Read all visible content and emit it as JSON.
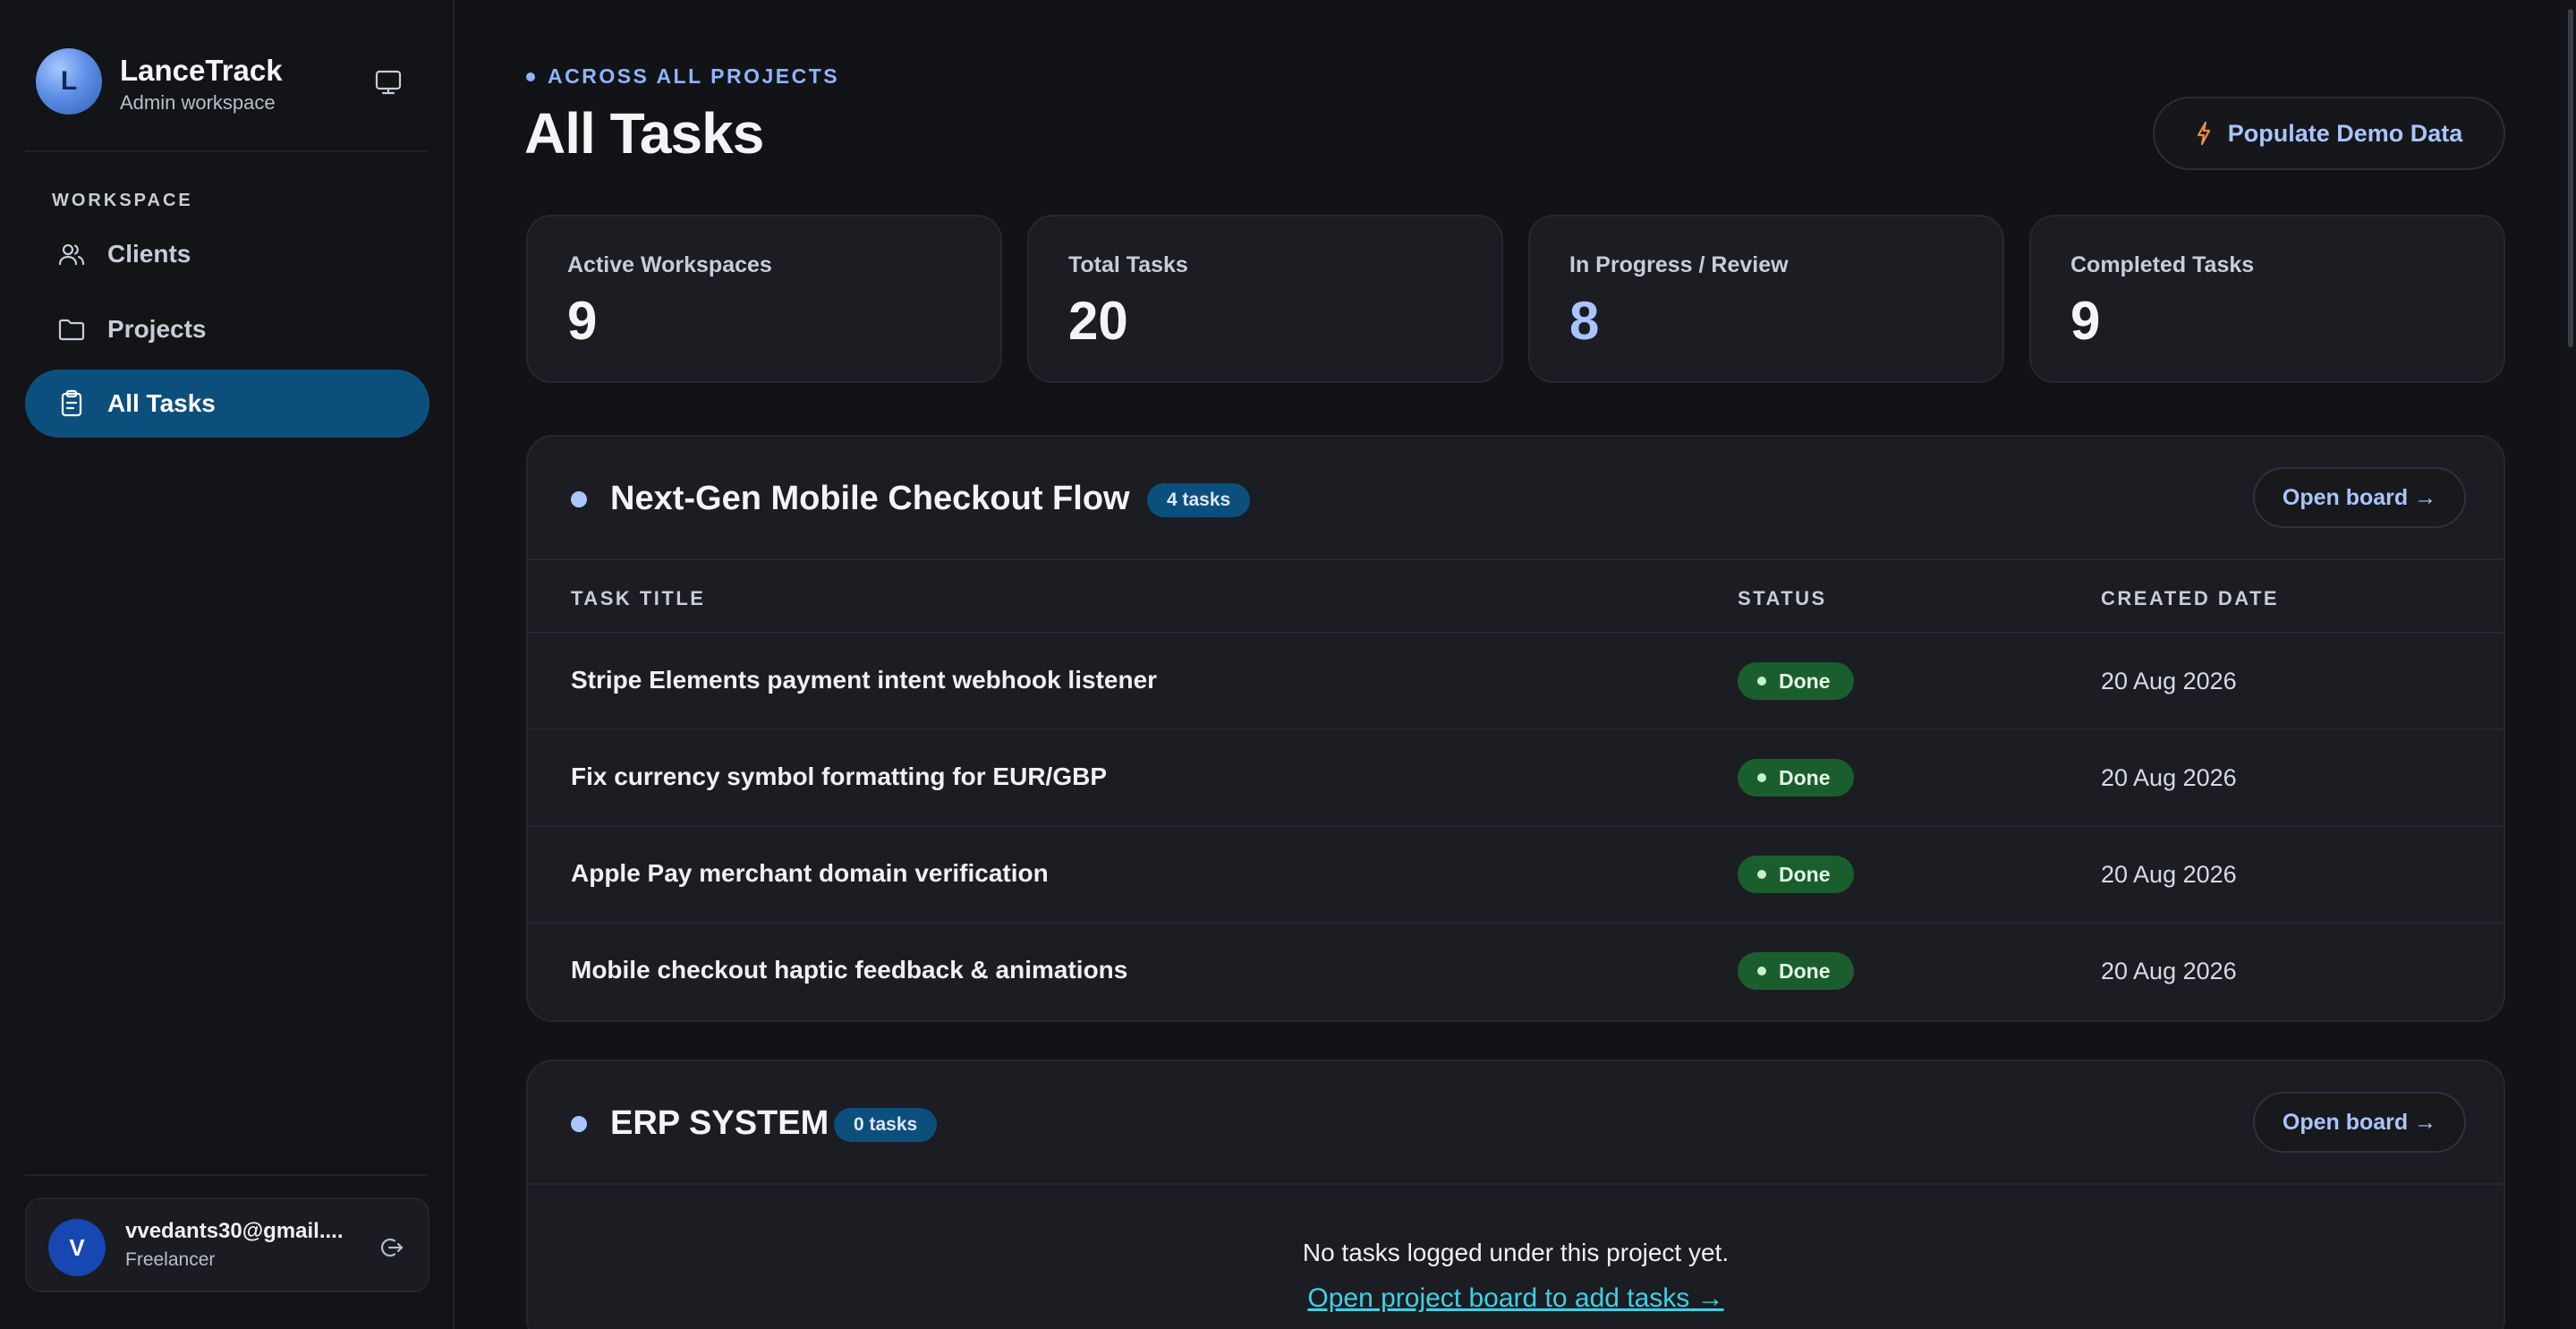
{
  "brand": {
    "initial": "L",
    "name": "LanceTrack",
    "subtitle": "Admin workspace"
  },
  "sidebar": {
    "section_label": "WORKSPACE",
    "items": [
      {
        "label": "Clients",
        "icon": "users-icon",
        "active": false
      },
      {
        "label": "Projects",
        "icon": "folder-icon",
        "active": false
      },
      {
        "label": "All Tasks",
        "icon": "clipboard-icon",
        "active": true
      }
    ]
  },
  "user": {
    "initial": "V",
    "email": "vvedants30@gmail....",
    "role": "Freelancer"
  },
  "header": {
    "kicker": "ACROSS ALL PROJECTS",
    "title": "All Tasks",
    "demo_button": "Populate Demo Data"
  },
  "stats": [
    {
      "label": "Active Workspaces",
      "value": "9"
    },
    {
      "label": "Total Tasks",
      "value": "20"
    },
    {
      "label": "In Progress / Review",
      "value": "8"
    },
    {
      "label": "Completed Tasks",
      "value": "9"
    }
  ],
  "table_headers": {
    "title": "TASK TITLE",
    "status": "STATUS",
    "created": "CREATED DATE"
  },
  "projects": [
    {
      "name": "Next-Gen Mobile Checkout Flow",
      "badge": "4 tasks",
      "open_label": "Open board →",
      "tasks": [
        {
          "title": "Stripe Elements payment intent webhook listener",
          "status": "Done",
          "created": "20 Aug 2026"
        },
        {
          "title": "Fix currency symbol formatting for EUR/GBP",
          "status": "Done",
          "created": "20 Aug 2026"
        },
        {
          "title": "Apple Pay merchant domain verification",
          "status": "Done",
          "created": "20 Aug 2026"
        },
        {
          "title": "Mobile checkout haptic feedback & animations",
          "status": "Done",
          "created": "20 Aug 2026"
        }
      ]
    },
    {
      "name": "ERP SYSTEM",
      "badge": "0 tasks",
      "open_label": "Open board →",
      "empty_message": "No tasks logged under this project yet.",
      "empty_link": "Open project board to add tasks →"
    }
  ],
  "colors": {
    "background": "#111317",
    "card": "#1b1d22",
    "accent": "#0d4f7c",
    "accent_text": "#a9c4ff",
    "done_pill": "#1b5e2e",
    "link": "#3fd0e6"
  }
}
